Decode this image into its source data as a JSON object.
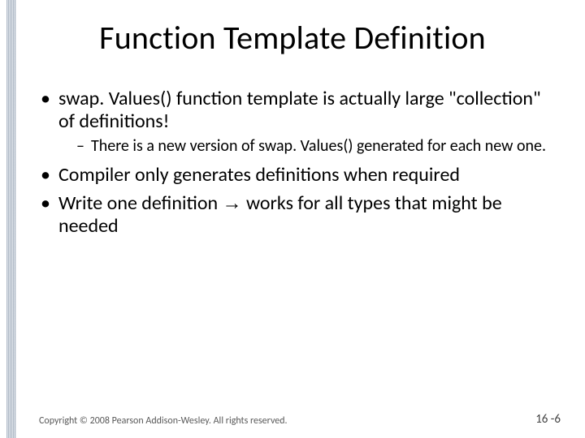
{
  "title": "Function Template Definition",
  "bullets": {
    "b1": "swap. Values() function template is actually large \"collection\" of definitions!",
    "b1_sub": "There is a new version of swap. Values() generated for each new one.",
    "b2": "Compiler only generates definitions when required",
    "b3_pre": "Write one definition ",
    "b3_arrow": "→",
    "b3_post": " works for all types that might be needed"
  },
  "footer": {
    "copyright": "Copyright © 2008 Pearson Addison-Wesley. All rights reserved.",
    "page": "16 -6"
  }
}
